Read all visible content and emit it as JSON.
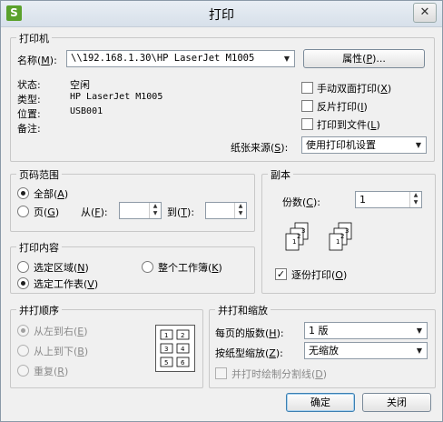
{
  "window": {
    "title": "打印",
    "app_icon": "S",
    "close_glyph": "✕"
  },
  "printer": {
    "group_label": "打印机",
    "name_label": "名称(",
    "name_key": "M",
    "name_label_end": "):",
    "name_value": "\\\\192.168.1.30\\HP LaserJet M1005",
    "properties_button": "属性(",
    "properties_key": "P",
    "properties_end": ")...",
    "status_label": "状态:",
    "status_value": "空闲",
    "type_label": "类型:",
    "type_value": "HP LaserJet M1005",
    "location_label": "位置:",
    "location_value": "USB001",
    "comment_label": "备注:",
    "duplex_label": "手动双面打印(",
    "duplex_key": "X",
    "duplex_end": ")",
    "reverse_label": "反片打印(",
    "reverse_key": "I",
    "reverse_end": ")",
    "tofile_label": "打印到文件(",
    "tofile_key": "L",
    "tofile_end": ")",
    "paper_source_label": "纸张来源(",
    "paper_source_key": "S",
    "paper_source_end": "):",
    "paper_source_value": "使用打印机设置"
  },
  "page_range": {
    "group_label": "页码范围",
    "all_label": "全部(",
    "all_key": "A",
    "all_end": ")",
    "pages_label": "页(",
    "pages_key": "G",
    "pages_end": ")",
    "from_label": "从(",
    "from_key": "F",
    "from_end": "):",
    "to_label": "到(",
    "to_key": "T",
    "to_end": "):"
  },
  "copies": {
    "group_label": "副本",
    "count_label": "份数(",
    "count_key": "C",
    "count_end": "):",
    "count_value": "1",
    "collate_label": "逐份打印(",
    "collate_key": "O",
    "collate_end": ")"
  },
  "print_content": {
    "group_label": "打印内容",
    "selection_label": "选定区域(",
    "selection_key": "N",
    "selection_end": ")",
    "workbook_label": "整个工作簿(",
    "workbook_key": "K",
    "workbook_end": ")",
    "sheet_label": "选定工作表(",
    "sheet_key": "V",
    "sheet_end": ")"
  },
  "order": {
    "group_label": "并打顺序",
    "ltr_label": "从左到右(",
    "ltr_key": "E",
    "ltr_end": ")",
    "ttb_label": "从上到下(",
    "ttb_key": "B",
    "ttb_end": ")",
    "repeat_label": "重复(",
    "repeat_key": "R",
    "repeat_end": ")",
    "preview_numbers": [
      "1",
      "2",
      "3",
      "4",
      "5",
      "6"
    ]
  },
  "zoom": {
    "group_label": "并打和缩放",
    "per_page_label": "每页的版数(",
    "per_page_key": "H",
    "per_page_end": "):",
    "per_page_value": "1 版",
    "scale_label": "按纸型缩放(",
    "scale_key": "Z",
    "scale_end": "):",
    "scale_value": "无缩放",
    "divider_label": "并打时绘制分割线(",
    "divider_key": "D",
    "divider_end": ")"
  },
  "buttons": {
    "ok": "确定",
    "close": "关闭"
  },
  "collate_preview_numbers": [
    "1",
    "2",
    "3",
    "1",
    "2",
    "3"
  ]
}
